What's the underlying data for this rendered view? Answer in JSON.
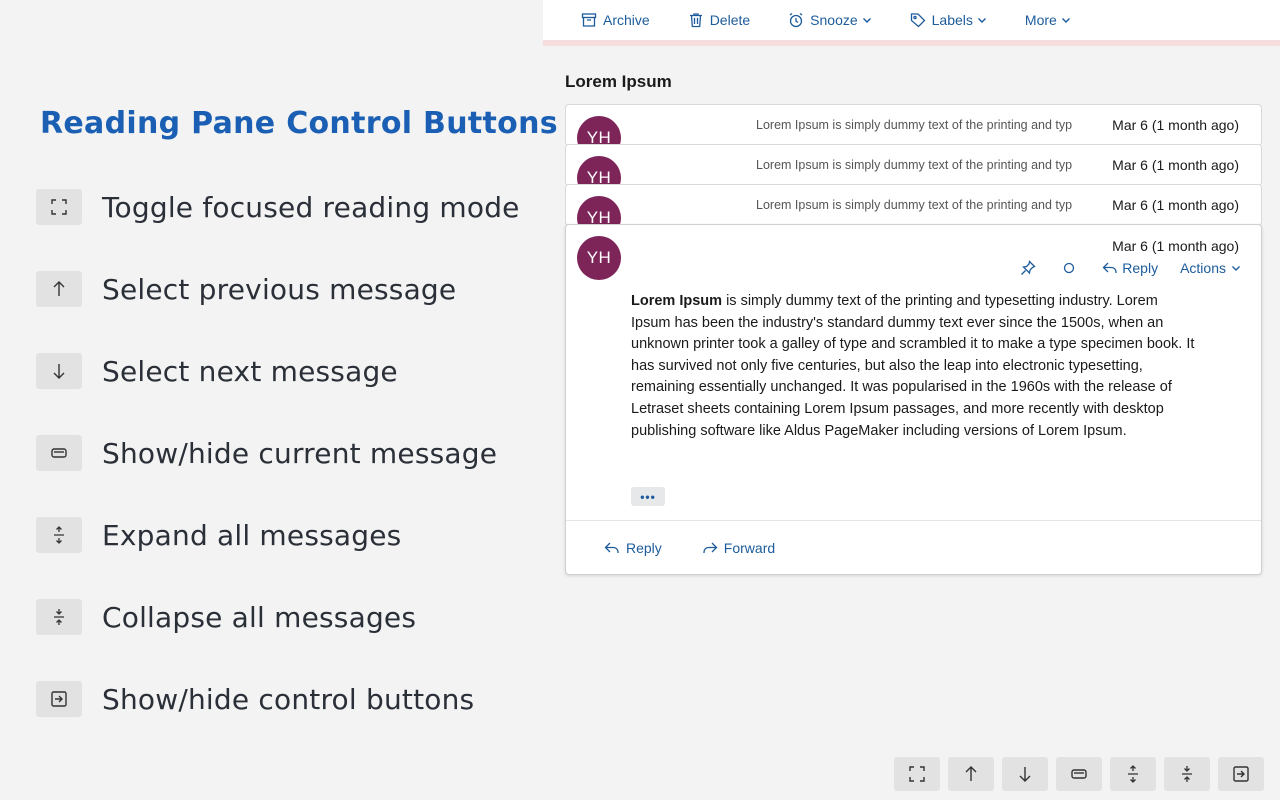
{
  "legend": {
    "title": "Reading Pane Control Buttons",
    "items": [
      {
        "icon": "focus-mode-icon",
        "label": "Toggle focused reading mode"
      },
      {
        "icon": "arrow-up-icon",
        "label": "Select previous message"
      },
      {
        "icon": "arrow-down-icon",
        "label": "Select next message"
      },
      {
        "icon": "message-toggle-icon",
        "label": "Show/hide current message"
      },
      {
        "icon": "expand-icon",
        "label": "Expand all messages"
      },
      {
        "icon": "collapse-icon",
        "label": "Collapse all messages"
      },
      {
        "icon": "panel-toggle-icon",
        "label": "Show/hide control buttons"
      }
    ]
  },
  "toolbar": {
    "archive": "Archive",
    "delete": "Delete",
    "snooze": "Snooze",
    "labels": "Labels",
    "more": "More"
  },
  "thread": {
    "title": "Lorem Ipsum",
    "collapsed": [
      {
        "initials": "YH",
        "snippet": "Lorem Ipsum is simply dummy text of the printing and typ",
        "date": "Mar 6 (1 month ago)"
      },
      {
        "initials": "YH",
        "snippet": "Lorem Ipsum is simply dummy text of the printing and typ",
        "date": "Mar 6 (1 month ago)"
      },
      {
        "initials": "YH",
        "snippet": "Lorem Ipsum is simply dummy text of the printing and typ",
        "date": "Mar 6 (1 month ago)"
      }
    ],
    "open": {
      "initials": "YH",
      "date": "Mar 6 (1 month ago)",
      "reply": "Reply",
      "actions": "Actions",
      "body_lead": "Lorem Ipsum",
      "body_rest": " is simply dummy text of the printing and typesetting industry. Lorem Ipsum has been the industry's standard dummy text ever since the 1500s, when an unknown printer took a galley of type and scrambled it to make a type specimen book. It has survived not only five centuries, but also the leap into electronic typesetting, remaining essentially unchanged. It was popularised in the 1960s with the release of Letraset sheets containing Lorem Ipsum passages, and more recently with desktop publishing software like Aldus PageMaker including versions of Lorem Ipsum.",
      "more": "•••",
      "footer_reply": "Reply",
      "footer_forward": "Forward"
    }
  },
  "colors": {
    "accent": "#1d5c9c",
    "legend_title": "#1a5fb4",
    "avatar": "#7d2458",
    "toolbar_border": "#f7dede"
  }
}
